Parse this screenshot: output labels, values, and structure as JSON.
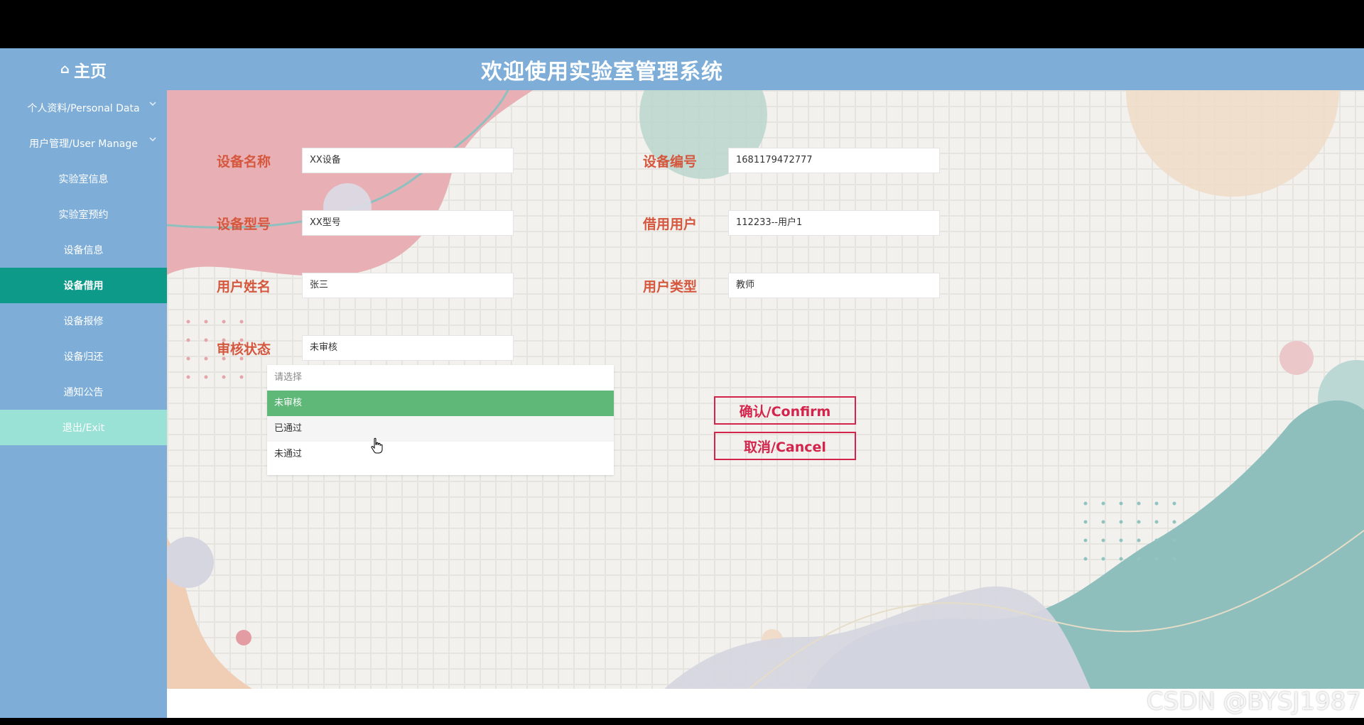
{
  "header": {
    "home_icon": "home-icon",
    "home_label": "主页",
    "title": "欢迎使用实验室管理系统"
  },
  "sidebar": {
    "items": [
      {
        "label": "个人资料/Personal Data",
        "chevron": "chevron-down-icon"
      },
      {
        "label": "用户管理/User Manage",
        "chevron": "chevron-down-icon"
      },
      {
        "label": "实验室信息"
      },
      {
        "label": "实验室预约"
      },
      {
        "label": "设备信息"
      },
      {
        "label": "设备借用",
        "active": true
      },
      {
        "label": "设备报修"
      },
      {
        "label": "设备归还"
      },
      {
        "label": "通知公告"
      },
      {
        "label": "退出/Exit"
      }
    ]
  },
  "form": {
    "device_name": {
      "label": "设备名称",
      "value": "XX设备"
    },
    "device_no": {
      "label": "设备编号",
      "value": "1681179472777"
    },
    "device_model": {
      "label": "设备型号",
      "value": "XX型号"
    },
    "borrow_user": {
      "label": "借用用户",
      "value": "112233--用户1"
    },
    "user_name": {
      "label": "用户姓名",
      "value": "张三"
    },
    "user_type": {
      "label": "用户类型",
      "value": "教师"
    },
    "audit_status": {
      "label": "审核状态",
      "value": "未审核",
      "options": [
        "请选择",
        "未审核",
        "已通过",
        "未通过"
      ],
      "selected": "未审核"
    }
  },
  "buttons": {
    "confirm": "确认/Confirm",
    "cancel": "取消/Cancel"
  },
  "watermark": "CSDN @BYSJ1987",
  "colors": {
    "header_bg": "#7eaed8",
    "active_item": "#0e9a88",
    "exit_item": "#9ae2d6",
    "label": "#d4573e",
    "button": "#d4244b",
    "option_selected": "#5fb878"
  }
}
